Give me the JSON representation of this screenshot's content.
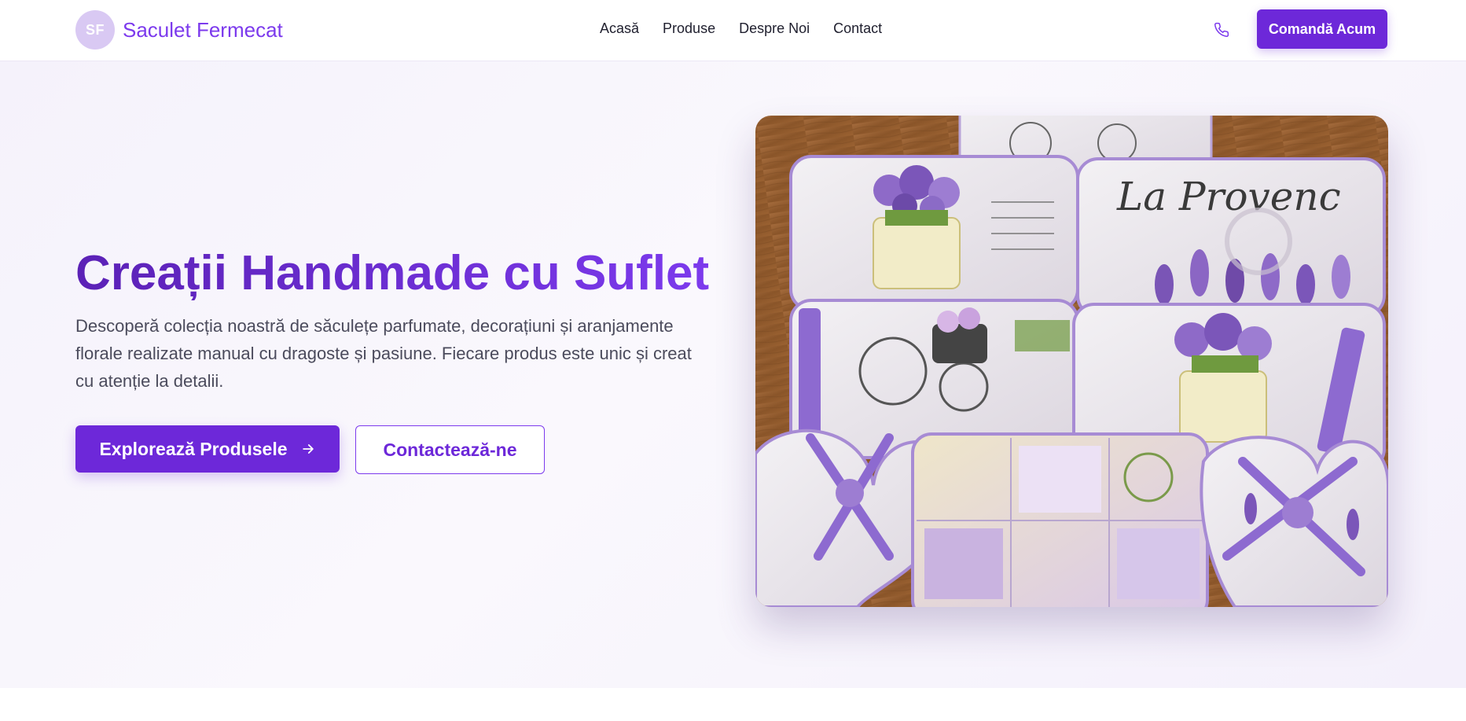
{
  "header": {
    "logo_initials": "SF",
    "brand_name": "Saculet Fermecat",
    "nav": [
      {
        "label": "Acasă"
      },
      {
        "label": "Produse"
      },
      {
        "label": "Despre Noi"
      },
      {
        "label": "Contact"
      }
    ],
    "phone_icon": "phone-icon",
    "order_label": "Comandă Acum"
  },
  "hero": {
    "title": "Creații Handmade cu Suflet",
    "description": "Descoperă colecția noastră de săculețe parfumate, decorațiuni și aranjamente florale realizate manual cu dragoste și pasiune. Fiecare produs este unic și creat cu atenție la detalii.",
    "primary_button": "Explorează Produsele",
    "primary_icon": "arrow-right-icon",
    "secondary_button": "Contactează-ne",
    "image_text": "La Provenc"
  },
  "colors": {
    "accent": "#6d28d9",
    "accent_light": "#7c3aed",
    "logo_bg": "#d9c9f3",
    "text_dark": "#1f1f2e",
    "text_body": "#4b4b5c"
  }
}
